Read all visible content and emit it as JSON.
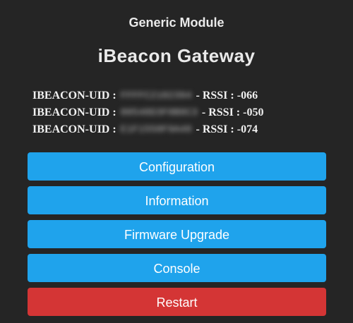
{
  "header": {
    "module_name": "Generic Module",
    "title": "iBeacon Gateway"
  },
  "beacons": [
    {
      "label": "IBEACON-UID :",
      "uid": "FFFFC2102394",
      "rssi_label": "- RSSI :",
      "rssi": "-066"
    },
    {
      "label": "IBEACON-UID :",
      "uid": "00548D3F0B8C3",
      "rssi_label": "- RSSI :",
      "rssi": "-050"
    },
    {
      "label": "IBEACON-UID :",
      "uid": "E1F1558F9A48",
      "rssi_label": "- RSSI :",
      "rssi": "-074"
    }
  ],
  "buttons": {
    "configuration": "Configuration",
    "information": "Information",
    "firmware_upgrade": "Firmware Upgrade",
    "console": "Console",
    "restart": "Restart"
  },
  "colors": {
    "background": "#252525",
    "primary_button": "#1fa3ec",
    "danger_button": "#d43535",
    "text": "#eaeaea"
  }
}
